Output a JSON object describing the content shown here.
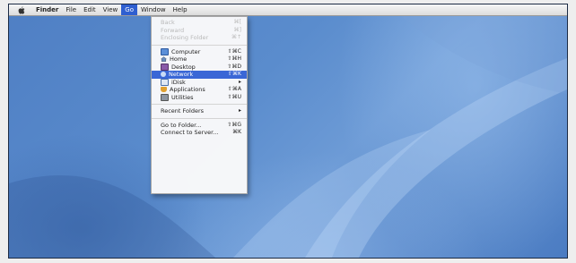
{
  "menubar": {
    "apple_icon": "apple-icon",
    "app_name": "Finder",
    "items": [
      "File",
      "Edit",
      "View",
      "Go",
      "Window",
      "Help"
    ],
    "active_item": "Go"
  },
  "go_menu": {
    "history": [
      {
        "label": "Back",
        "shortcut": "⌘[",
        "enabled": false
      },
      {
        "label": "Forward",
        "shortcut": "⌘]",
        "enabled": false
      },
      {
        "label": "Enclosing Folder",
        "shortcut": "⌘↑",
        "enabled": false
      }
    ],
    "places": [
      {
        "label": "Computer",
        "shortcut": "⇧⌘C",
        "icon": "computer-icon"
      },
      {
        "label": "Home",
        "shortcut": "⇧⌘H",
        "icon": "home-icon"
      },
      {
        "label": "Desktop",
        "shortcut": "⇧⌘D",
        "icon": "desktop-icon"
      },
      {
        "label": "Network",
        "shortcut": "⇧⌘K",
        "icon": "network-icon",
        "highlighted": true
      },
      {
        "label": "iDisk",
        "shortcut": "▸",
        "icon": "idisk-icon"
      },
      {
        "label": "Applications",
        "shortcut": "⇧⌘A",
        "icon": "applications-icon"
      },
      {
        "label": "Utilities",
        "shortcut": "⇧⌘U",
        "icon": "utilities-icon"
      }
    ],
    "recent": {
      "label": "Recent Folders",
      "shortcut": "▸"
    },
    "folder_actions": [
      {
        "label": "Go to Folder...",
        "shortcut": "⇧⌘G"
      },
      {
        "label": "Connect to Server...",
        "shortcut": "⌘K"
      }
    ]
  },
  "colors": {
    "highlight": "#3a67d6",
    "desktop": "#5a8ccd"
  }
}
